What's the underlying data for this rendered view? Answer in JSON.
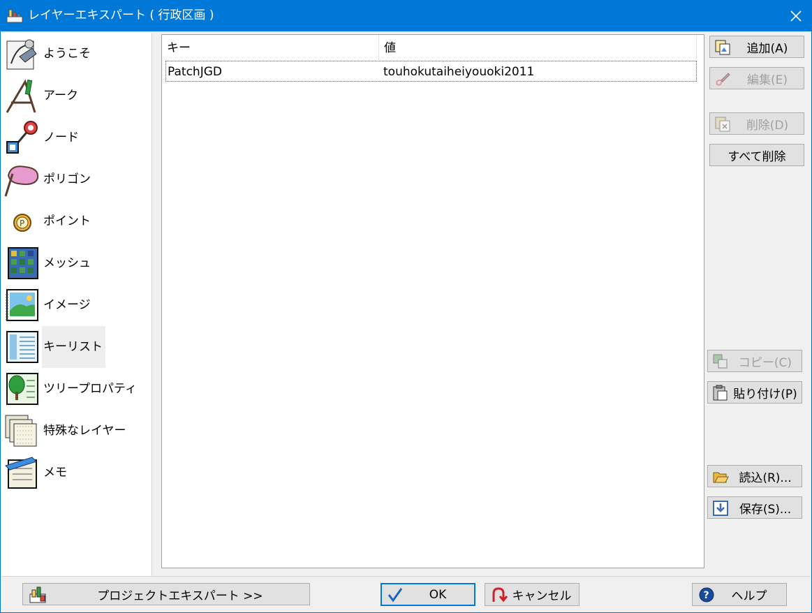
{
  "window": {
    "title": "レイヤーエキスパート ( 行政区画 )"
  },
  "sidebar": {
    "items": [
      {
        "label": "ようこそ",
        "icon": "welcome-icon"
      },
      {
        "label": "アーク",
        "icon": "arc-icon"
      },
      {
        "label": "ノード",
        "icon": "node-icon"
      },
      {
        "label": "ポリゴン",
        "icon": "polygon-icon"
      },
      {
        "label": "ポイント",
        "icon": "point-icon"
      },
      {
        "label": "メッシュ",
        "icon": "mesh-icon"
      },
      {
        "label": "イメージ",
        "icon": "image-icon"
      },
      {
        "label": "キーリスト",
        "icon": "keylist-icon",
        "selected": true
      },
      {
        "label": "ツリープロパティ",
        "icon": "tree-property-icon"
      },
      {
        "label": "特殊なレイヤー",
        "icon": "special-layer-icon"
      },
      {
        "label": "メモ",
        "icon": "memo-icon"
      }
    ]
  },
  "keylist": {
    "headers": {
      "key": "キー",
      "value": "値"
    },
    "rows": [
      {
        "key": "PatchJGD",
        "value": "touhokutaiheiyouoki2011"
      }
    ]
  },
  "buttons": {
    "add": "追加(A)",
    "edit": "編集(E)",
    "delete": "削除(D)",
    "delete_all": "すべて削除",
    "copy": "コピー(C)",
    "paste": "貼り付け(P)",
    "load": "読込(R)...",
    "save": "保存(S)...",
    "project_expert": "プロジェクトエキスパート >>",
    "ok": "OK",
    "cancel": "キャンセル",
    "help": "ヘルプ"
  },
  "colors": {
    "titlebar": "#0078d7",
    "selected_item": "#eeeeee",
    "disabled_text": "#a0a0a0"
  }
}
